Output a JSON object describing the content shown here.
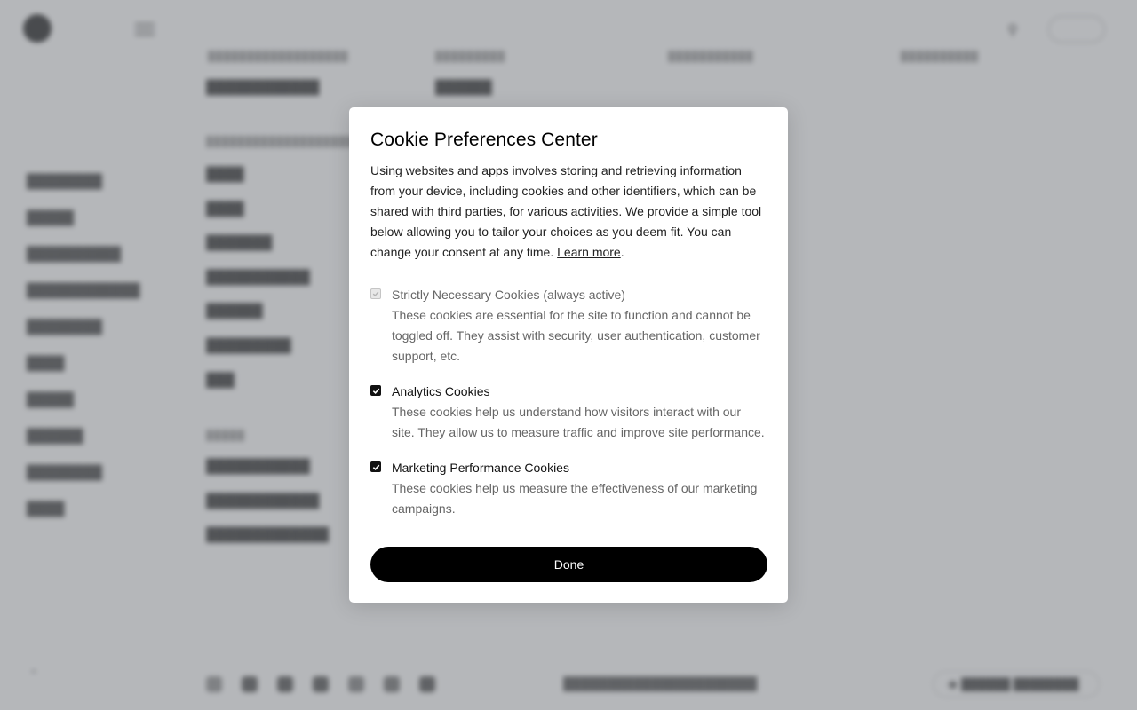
{
  "modal": {
    "title": "Cookie Preferences Center",
    "intro": "Using websites and apps involves storing and retrieving information from your device, including cookies and other identifiers, which can be shared with third parties, for various activities. We provide a simple tool below allowing you to tailor your choices as you deem fit. You can change your consent at any time.",
    "learn_more": "Learn more",
    "period": ".",
    "options": [
      {
        "label": "Strictly Necessary Cookies (always active)",
        "description": "These cookies are essential for the site to function and cannot be toggled off. They assist with security, user authentication, customer support, etc.",
        "checked": true,
        "disabled": true
      },
      {
        "label": "Analytics Cookies",
        "description": "These cookies help us understand how visitors interact with our site. They allow us to measure traffic and improve site performance.",
        "checked": true,
        "disabled": false
      },
      {
        "label": "Marketing Performance Cookies",
        "description": "These cookies help us measure the effectiveness of our marketing campaigns.",
        "checked": true,
        "disabled": false
      }
    ],
    "done_label": "Done"
  },
  "colors": {
    "overlay": "#787b82",
    "button_bg": "#000000",
    "button_text": "#ffffff"
  },
  "icons": {
    "checkbox_checked": "check-icon"
  }
}
